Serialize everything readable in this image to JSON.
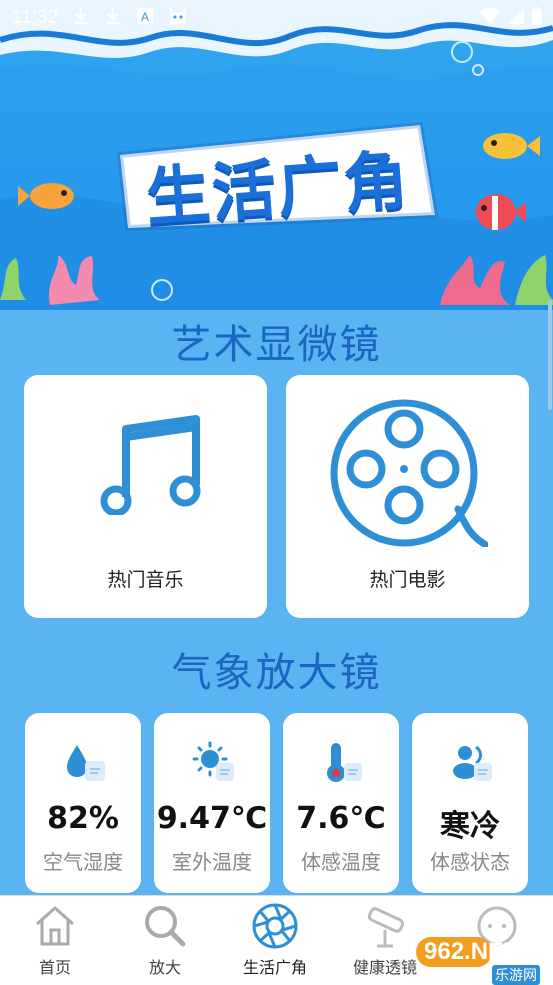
{
  "status_bar": {
    "time": "11:32"
  },
  "banner": {
    "title": "生活广角"
  },
  "art_section": {
    "title": "艺术显微镜",
    "cards": [
      {
        "label": "热门音乐",
        "icon": "music-note-icon"
      },
      {
        "label": "热门电影",
        "icon": "film-reel-icon"
      }
    ]
  },
  "weather_section": {
    "title": "气象放大镜",
    "cards": [
      {
        "value": "82%",
        "caption": "空气湿度",
        "icon": "humidity-icon"
      },
      {
        "value": "9.47℃",
        "caption": "室外温度",
        "icon": "sun-icon"
      },
      {
        "value": "7.6℃",
        "caption": "体感温度",
        "icon": "thermometer-icon"
      },
      {
        "value": "寒冷",
        "caption": "体感状态",
        "icon": "person-status-icon"
      }
    ]
  },
  "bottom_nav": {
    "items": [
      {
        "label": "首页",
        "icon": "home-icon"
      },
      {
        "label": "放大",
        "icon": "magnifier-icon"
      },
      {
        "label": "生活广角",
        "icon": "aperture-icon",
        "active": true
      },
      {
        "label": "健康透镜",
        "icon": "telescope-icon"
      },
      {
        "label": "",
        "icon": "chat-bubble-icon"
      }
    ]
  },
  "watermark": {
    "brand": "962.NET",
    "sub": "乐游网"
  },
  "colors": {
    "background": "#5ab4f2",
    "title_blue": "#1a66c2",
    "icon_blue": "#2f8fd6",
    "active_nav": "#2f8fd6"
  }
}
